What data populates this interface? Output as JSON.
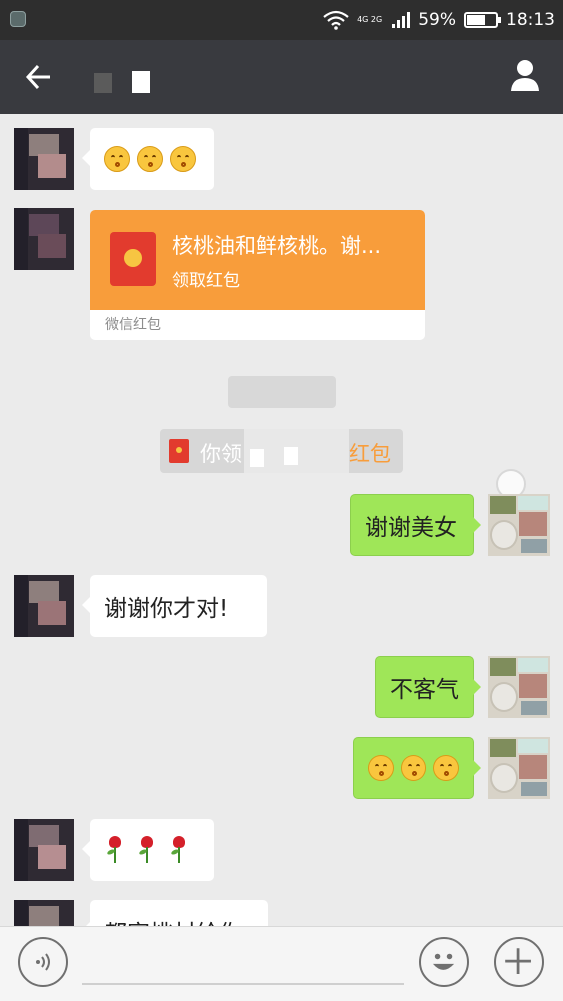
{
  "status_bar": {
    "network": "4G 2G",
    "battery": "59%",
    "battery_level": 0.59,
    "time": "18:13",
    "icons": [
      "notification-icon",
      "wifi-icon",
      "signal-icon",
      "battery-icon"
    ]
  },
  "header": {
    "back_icon": "back-arrow-icon",
    "title": "",
    "profile_icon": "person-icon"
  },
  "messages": {
    "m1": {
      "from": "contact",
      "content": "emoji-row",
      "emoji": [
        "kiss-emoji",
        "kiss-emoji",
        "kiss-emoji"
      ]
    },
    "m2": {
      "from": "contact",
      "type": "red-packet",
      "title": "核桃油和鲜核桃。谢...",
      "action": "领取红包",
      "footer": "微信红包"
    },
    "system": {
      "lead": "你领",
      "tail": "红包"
    },
    "m3": {
      "from": "me",
      "text": "谢谢美女"
    },
    "m4": {
      "from": "contact",
      "text": "谢谢你才对!"
    },
    "m5": {
      "from": "me",
      "text": "不客气"
    },
    "m6": {
      "from": "me",
      "content": "emoji-row",
      "emoji": [
        "kiss-emoji",
        "kiss-emoji",
        "kiss-emoji"
      ]
    },
    "m7": {
      "from": "contact",
      "content": "rose-row",
      "emoji": [
        "rose-emoji",
        "rose-emoji",
        "rose-emoji"
      ]
    },
    "m8": {
      "from": "contact",
      "text": "都家挑材给你"
    }
  },
  "input_bar": {
    "voice_icon": "voice-icon",
    "emoji_icon": "smiley-icon",
    "add_icon": "plus-icon"
  }
}
